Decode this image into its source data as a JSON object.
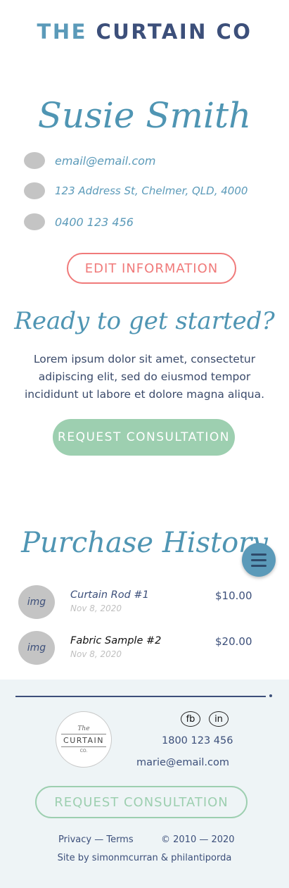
{
  "brand": {
    "the": "THE",
    "rest": "CURTAIN CO"
  },
  "profile": {
    "name": "Susie Smith",
    "email": "email@email.com",
    "address": "123 Address St, Chelmer, QLD, 4000",
    "phone": "0400 123 456",
    "edit_label": "EDIT INFORMATION"
  },
  "cta": {
    "heading": "Ready to get started?",
    "body": "Lorem ipsum dolor sit amet, consectetur adipiscing elit, sed do eiusmod tempor incididunt ut labore et dolore magna aliqua.",
    "button_label": "REQUEST CONSULTATION"
  },
  "purchase_history": {
    "heading": "Purchase History",
    "items": [
      {
        "img": "img",
        "name": "Curtain Rod #1",
        "date": "Nov 8, 2020",
        "price": "$10.00"
      },
      {
        "img": "img",
        "name": "Fabric Sample #2",
        "date": "Nov 8, 2020",
        "price": "$20.00"
      }
    ]
  },
  "menu": {
    "icon": "hamburger-icon"
  },
  "footer": {
    "logo": {
      "the": "The",
      "curtain": "CURTAIN",
      "co": "CO."
    },
    "social": {
      "fb": "fb",
      "in": "in"
    },
    "phone": "1800 123 456",
    "email": "marie@email.com",
    "button_label": "REQUEST CONSULTATION",
    "privacy_terms": "Privacy — Terms",
    "copyright": "© 2010 — 2020",
    "credit": "Site by simonmcurran & philantiporda"
  },
  "colors": {
    "accent_blue": "#5b9ab9",
    "navy": "#3c4f7a",
    "coral": "#f07a7a",
    "mint": "#9dcfb0",
    "footer_bg": "#eef4f6"
  }
}
